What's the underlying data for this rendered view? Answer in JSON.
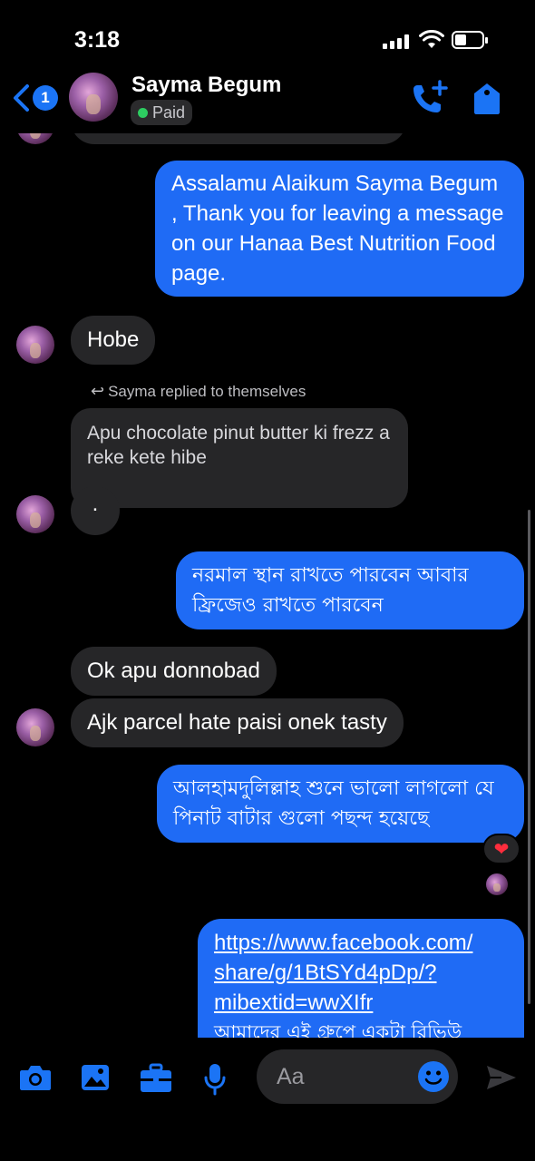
{
  "status": {
    "time": "3:18"
  },
  "header": {
    "back_count": "1",
    "name": "Sayma Begum",
    "label": "Paid"
  },
  "messages": {
    "m1": "Assalamu Alaikum Sayma Begum , Thank you for leaving a message on our Hanaa Best Nutrition Food page.",
    "m2": "Hobe",
    "reply_note": "Sayma replied to themselves",
    "quoted": "Apu chocolate pinut butter ki frezz a reke kete hibe",
    "dot": ".",
    "m3": "নরমাল স্থান রাখতে পারবেন আবার ফ্রিজেও রাখতে পারবেন",
    "m4": "Ok apu donnobad",
    "m5": "Ajk parcel hate paisi onek tasty",
    "m6": "আলহামদুলিল্লাহ শুনে ভালো লাগলো যে পিনাট বাটার গুলো পছন্দ হয়েছে",
    "m7_link1": "https://www.facebook.com/",
    "m7_link2": "share/g/1BtSYd4pDp/?",
    "m7_link3": "mibextid=wwXIfr",
    "m7_text": "আমাদের এই গ্রুপে একটা রিভিউ"
  },
  "reaction": "❤",
  "composer": {
    "placeholder": "Aa"
  },
  "colors": {
    "accent": "#1f6bf5",
    "incoming": "#262628",
    "paid_dot": "#2dcc61"
  }
}
